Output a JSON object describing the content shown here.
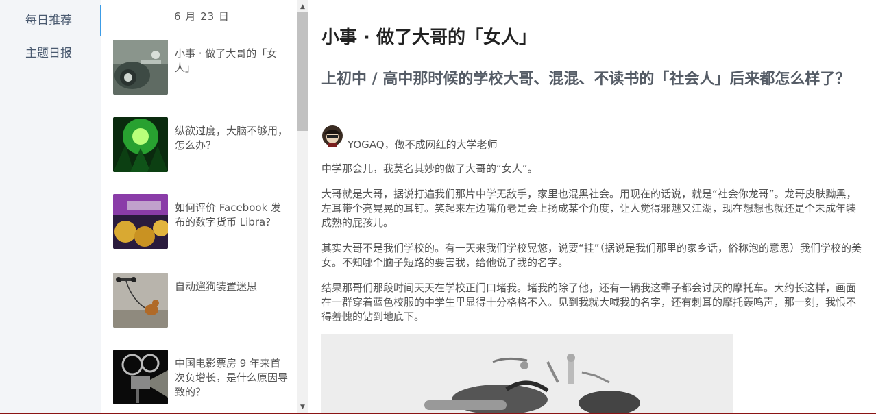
{
  "nav": {
    "items": [
      {
        "label": "每日推荐"
      },
      {
        "label": "主题日报"
      }
    ]
  },
  "list": {
    "date": "6 月 23 日",
    "items": [
      {
        "title": "小事 · 做了大哥的「女人」"
      },
      {
        "title": "纵欲过度，大脑不够用，怎么办？"
      },
      {
        "title": "如何评价 Facebook 发布的数字货币 Libra?"
      },
      {
        "title": "自动遛狗装置迷思"
      },
      {
        "title": "中国电影票房 9 年来首次负增长，是什么原因导致的？"
      }
    ]
  },
  "article": {
    "title": "小事 · 做了大哥的「女人」",
    "question": "上初中 / 高中那时候的学校大哥、混混、不读书的「社会人」后来都怎么样了？",
    "author": "YOGAQ，做不成网红的大学老师",
    "paragraphs": [
      "中学那会儿，我莫名其妙的做了大哥的“女人”。",
      "大哥就是大哥，据说打遍我们那片中学无敌手，家里也混黑社会。用现在的话说，就是“社会你龙哥”。龙哥皮肤黝黑，左耳带个亮晃晃的耳钉。笑起来左边嘴角老是会上扬成某个角度，让人觉得邪魅又江湖，现在想想也就还是个未成年装成熟的屁孩儿。",
      "其实大哥不是我们学校的。有一天来我们学校晃悠，说要“挂”（据说是我们那里的家乡话，俗称泡的意思）我们学校的美女。不知哪个脑子短路的要害我，给他说了我的名字。",
      "结果那哥们那段时间天天在学校正门口堵我。堵我的除了他，还有一辆我这辈子都会讨厌的摩托车。大约长这样，画面在一群穿着蓝色校服的中学生里显得十分格格不入。见到我就大喊我的名字，还有刺耳的摩托轰鸣声，那一刻，我恨不得羞愧的钻到地底下。"
    ]
  },
  "colors": {
    "accent": "#3c9ce6",
    "nav_bg": "#f3f5f8",
    "title": "#222222",
    "text": "#555555"
  }
}
